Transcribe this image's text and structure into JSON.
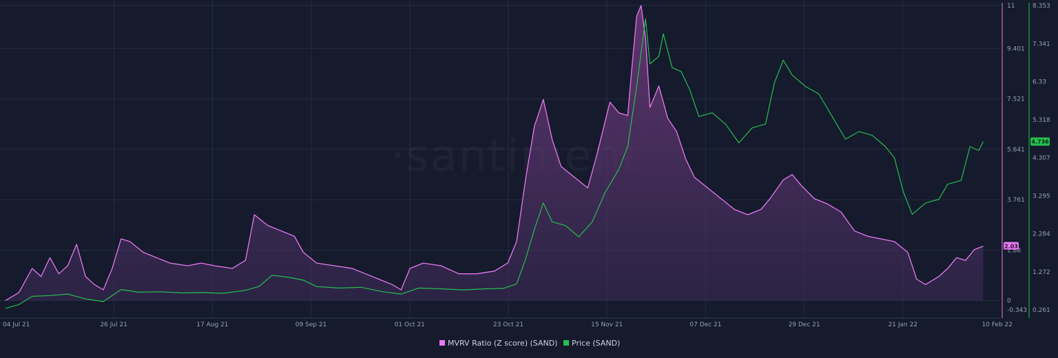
{
  "watermark": "·santiment·",
  "chart_data": {
    "type": "line",
    "x_tick_labels": [
      "04 Jul 21",
      "26 Jul 21",
      "17 Aug 21",
      "09 Sep 21",
      "01 Oct 21",
      "23 Oct 21",
      "15 Nov 21",
      "07 Dec 21",
      "29 Dec 21",
      "21 Jan 22",
      "10 Feb 22"
    ],
    "x_range": [
      "2021-07-04",
      "2022-02-10"
    ],
    "left_axis": {
      "series": "MVRV Ratio (Z score) (SAND)",
      "range": [
        -0.343,
        11
      ],
      "tick_labels": [
        "11",
        "9.401",
        "7.521",
        "5.641",
        "3.761",
        "1.88",
        "0",
        "-0.343"
      ],
      "tick_values": [
        11,
        9.401,
        7.521,
        5.641,
        3.761,
        1.88,
        0,
        -0.343
      ],
      "color": "#e879f0"
    },
    "right_axis": {
      "series": "Price (SAND)",
      "range": [
        0.261,
        8.353
      ],
      "tick_labels": [
        "8.353",
        "7.341",
        "6.33",
        "5.318",
        "4.307",
        "3.295",
        "2.284",
        "1.272",
        "0.261"
      ],
      "tick_values": [
        8.353,
        7.341,
        6.33,
        5.318,
        4.307,
        3.295,
        2.284,
        1.272,
        0.261
      ],
      "color": "#26c04f"
    },
    "current_values": {
      "mvrv": "2.03",
      "price": "4.736"
    },
    "legend": [
      {
        "label": "MVRV Ratio (Z score) (SAND)",
        "color": "#e879f0"
      },
      {
        "label": "Price (SAND)",
        "color": "#26c04f"
      }
    ],
    "legend_position": "bottom-center",
    "grid": true,
    "series": [
      {
        "name": "MVRV Ratio (Z score) (SAND)",
        "axis": "left",
        "points": [
          [
            "2021-07-04",
            0.0
          ],
          [
            "2021-07-07",
            0.3
          ],
          [
            "2021-07-10",
            1.2
          ],
          [
            "2021-07-12",
            0.9
          ],
          [
            "2021-07-14",
            1.6
          ],
          [
            "2021-07-16",
            1.0
          ],
          [
            "2021-07-18",
            1.3
          ],
          [
            "2021-07-20",
            2.1
          ],
          [
            "2021-07-22",
            0.9
          ],
          [
            "2021-07-24",
            0.6
          ],
          [
            "2021-07-26",
            0.4
          ],
          [
            "2021-07-28",
            1.2
          ],
          [
            "2021-07-30",
            2.3
          ],
          [
            "2021-08-01",
            2.2
          ],
          [
            "2021-08-04",
            1.8
          ],
          [
            "2021-08-07",
            1.6
          ],
          [
            "2021-08-10",
            1.4
          ],
          [
            "2021-08-14",
            1.3
          ],
          [
            "2021-08-17",
            1.4
          ],
          [
            "2021-08-20",
            1.3
          ],
          [
            "2021-08-24",
            1.2
          ],
          [
            "2021-08-27",
            1.5
          ],
          [
            "2021-08-29",
            3.2
          ],
          [
            "2021-09-01",
            2.8
          ],
          [
            "2021-09-04",
            2.6
          ],
          [
            "2021-09-07",
            2.4
          ],
          [
            "2021-09-09",
            1.8
          ],
          [
            "2021-09-12",
            1.4
          ],
          [
            "2021-09-16",
            1.3
          ],
          [
            "2021-09-20",
            1.2
          ],
          [
            "2021-09-23",
            1.0
          ],
          [
            "2021-09-26",
            0.8
          ],
          [
            "2021-09-29",
            0.6
          ],
          [
            "2021-10-01",
            0.4
          ],
          [
            "2021-10-03",
            1.2
          ],
          [
            "2021-10-06",
            1.4
          ],
          [
            "2021-10-10",
            1.3
          ],
          [
            "2021-10-14",
            1.0
          ],
          [
            "2021-10-18",
            1.0
          ],
          [
            "2021-10-22",
            1.1
          ],
          [
            "2021-10-25",
            1.4
          ],
          [
            "2021-10-27",
            2.2
          ],
          [
            "2021-10-29",
            4.5
          ],
          [
            "2021-10-31",
            6.5
          ],
          [
            "2021-11-02",
            7.5
          ],
          [
            "2021-11-04",
            6.0
          ],
          [
            "2021-11-06",
            5.0
          ],
          [
            "2021-11-09",
            4.6
          ],
          [
            "2021-11-12",
            4.2
          ],
          [
            "2021-11-14",
            5.4
          ],
          [
            "2021-11-17",
            7.4
          ],
          [
            "2021-11-19",
            7.0
          ],
          [
            "2021-11-21",
            6.9
          ],
          [
            "2021-11-22",
            8.8
          ],
          [
            "2021-11-23",
            10.6
          ],
          [
            "2021-11-24",
            11.0
          ],
          [
            "2021-11-25",
            9.8
          ],
          [
            "2021-11-26",
            7.2
          ],
          [
            "2021-11-28",
            8.0
          ],
          [
            "2021-11-30",
            6.8
          ],
          [
            "2021-12-02",
            6.3
          ],
          [
            "2021-12-04",
            5.3
          ],
          [
            "2021-12-06",
            4.6
          ],
          [
            "2021-12-09",
            4.2
          ],
          [
            "2021-12-12",
            3.8
          ],
          [
            "2021-12-15",
            3.4
          ],
          [
            "2021-12-18",
            3.2
          ],
          [
            "2021-12-21",
            3.4
          ],
          [
            "2021-12-23",
            3.8
          ],
          [
            "2021-12-26",
            4.5
          ],
          [
            "2021-12-28",
            4.7
          ],
          [
            "2021-12-30",
            4.3
          ],
          [
            "2022-01-02",
            3.8
          ],
          [
            "2022-01-05",
            3.6
          ],
          [
            "2022-01-08",
            3.3
          ],
          [
            "2022-01-11",
            2.6
          ],
          [
            "2022-01-14",
            2.4
          ],
          [
            "2022-01-17",
            2.3
          ],
          [
            "2022-01-20",
            2.2
          ],
          [
            "2022-01-23",
            1.8
          ],
          [
            "2022-01-25",
            0.8
          ],
          [
            "2022-01-27",
            0.6
          ],
          [
            "2022-01-30",
            0.9
          ],
          [
            "2022-02-01",
            1.2
          ],
          [
            "2022-02-03",
            1.6
          ],
          [
            "2022-02-05",
            1.5
          ],
          [
            "2022-02-07",
            1.9
          ],
          [
            "2022-02-09",
            2.03
          ]
        ]
      },
      {
        "name": "Price (SAND)",
        "axis": "right",
        "points": [
          [
            "2021-07-04",
            0.3
          ],
          [
            "2021-07-07",
            0.4
          ],
          [
            "2021-07-10",
            0.62
          ],
          [
            "2021-07-14",
            0.64
          ],
          [
            "2021-07-18",
            0.68
          ],
          [
            "2021-07-22",
            0.55
          ],
          [
            "2021-07-26",
            0.48
          ],
          [
            "2021-07-30",
            0.8
          ],
          [
            "2021-08-03",
            0.73
          ],
          [
            "2021-08-08",
            0.74
          ],
          [
            "2021-08-13",
            0.71
          ],
          [
            "2021-08-17",
            0.72
          ],
          [
            "2021-08-22",
            0.7
          ],
          [
            "2021-08-27",
            0.78
          ],
          [
            "2021-08-30",
            0.88
          ],
          [
            "2021-09-02",
            1.18
          ],
          [
            "2021-09-06",
            1.12
          ],
          [
            "2021-09-09",
            1.05
          ],
          [
            "2021-09-12",
            0.88
          ],
          [
            "2021-09-17",
            0.84
          ],
          [
            "2021-09-22",
            0.86
          ],
          [
            "2021-09-27",
            0.74
          ],
          [
            "2021-10-01",
            0.68
          ],
          [
            "2021-10-05",
            0.84
          ],
          [
            "2021-10-10",
            0.82
          ],
          [
            "2021-10-15",
            0.79
          ],
          [
            "2021-10-20",
            0.82
          ],
          [
            "2021-10-24",
            0.83
          ],
          [
            "2021-10-27",
            0.95
          ],
          [
            "2021-10-29",
            1.6
          ],
          [
            "2021-10-31",
            2.4
          ],
          [
            "2021-11-02",
            3.1
          ],
          [
            "2021-11-04",
            2.6
          ],
          [
            "2021-11-07",
            2.5
          ],
          [
            "2021-11-10",
            2.2
          ],
          [
            "2021-11-13",
            2.6
          ],
          [
            "2021-11-16",
            3.4
          ],
          [
            "2021-11-19",
            4.0
          ],
          [
            "2021-11-21",
            4.6
          ],
          [
            "2021-11-23",
            6.2
          ],
          [
            "2021-11-25",
            8.0
          ],
          [
            "2021-11-26",
            6.8
          ],
          [
            "2021-11-28",
            7.0
          ],
          [
            "2021-11-29",
            7.6
          ],
          [
            "2021-12-01",
            6.7
          ],
          [
            "2021-12-03",
            6.6
          ],
          [
            "2021-12-05",
            6.1
          ],
          [
            "2021-12-07",
            5.4
          ],
          [
            "2021-12-10",
            5.5
          ],
          [
            "2021-12-13",
            5.2
          ],
          [
            "2021-12-16",
            4.7
          ],
          [
            "2021-12-19",
            5.1
          ],
          [
            "2021-12-22",
            5.2
          ],
          [
            "2021-12-24",
            6.3
          ],
          [
            "2021-12-26",
            6.9
          ],
          [
            "2021-12-28",
            6.5
          ],
          [
            "2021-12-31",
            6.2
          ],
          [
            "2022-01-03",
            6.0
          ],
          [
            "2022-01-06",
            5.4
          ],
          [
            "2022-01-09",
            4.8
          ],
          [
            "2022-01-12",
            5.0
          ],
          [
            "2022-01-15",
            4.9
          ],
          [
            "2022-01-18",
            4.6
          ],
          [
            "2022-01-20",
            4.3
          ],
          [
            "2022-01-22",
            3.4
          ],
          [
            "2022-01-24",
            2.8
          ],
          [
            "2022-01-27",
            3.1
          ],
          [
            "2022-01-30",
            3.2
          ],
          [
            "2022-02-01",
            3.6
          ],
          [
            "2022-02-04",
            3.7
          ],
          [
            "2022-02-06",
            4.6
          ],
          [
            "2022-02-08",
            4.5
          ],
          [
            "2022-02-09",
            4.736
          ]
        ]
      }
    ]
  }
}
